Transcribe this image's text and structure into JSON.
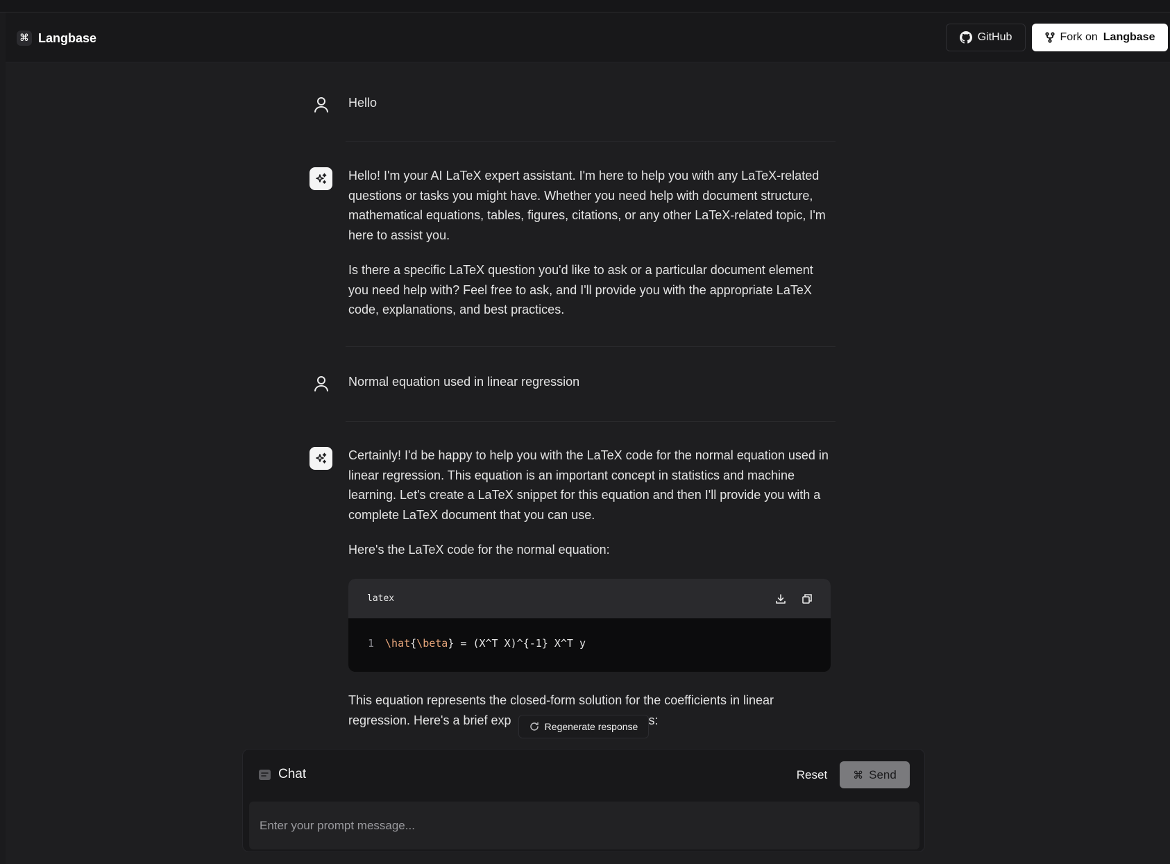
{
  "header": {
    "brand": "Langbase",
    "github_label": "GitHub",
    "fork_prefix": "Fork on",
    "fork_brand": "Langbase"
  },
  "messages": [
    {
      "role": "user",
      "text": "Hello"
    },
    {
      "role": "assistant",
      "paragraphs": [
        "Hello! I'm your AI LaTeX expert assistant. I'm here to help you with any LaTeX-related questions or tasks you might have. Whether you need help with document structure, mathematical equations, tables, figures, citations, or any other LaTeX-related topic, I'm here to assist you.",
        "Is there a specific LaTeX question you'd like to ask or a particular document element you need help with? Feel free to ask, and I'll provide you with the appropriate LaTeX code, explanations, and best practices."
      ]
    },
    {
      "role": "user",
      "text": "Normal equation used in linear regression"
    },
    {
      "role": "assistant",
      "paragraphs": [
        "Certainly! I'd be happy to help you with the LaTeX code for the normal equation used in linear regression. This equation is an important concept in statistics and machine learning. Let's create a LaTeX snippet for this equation and then I'll provide you with a complete LaTeX document that you can use.",
        "Here's the LaTeX code for the normal equation:"
      ],
      "code": {
        "language": "latex",
        "line_number": "1",
        "tokens": {
          "hat": "\\hat",
          "brace_open": "{",
          "beta": "\\beta",
          "rest": "} = (X^T X)^{-1} X^T y"
        }
      },
      "after_code_start": "This equation represents the closed-form solution for the coefficients in linear regression. Here's a brief exp",
      "after_code_end": "s:"
    }
  ],
  "regenerate_label": "Regenerate response",
  "composer": {
    "title": "Chat",
    "reset_label": "Reset",
    "send_label": "Send",
    "placeholder": "Enter your prompt message..."
  },
  "colors": {
    "background": "#1e1e20",
    "header": "#18181a",
    "accent_white": "#ffffff",
    "code_keyword": "#e6a57a",
    "send_button": "#7a7a7d"
  }
}
